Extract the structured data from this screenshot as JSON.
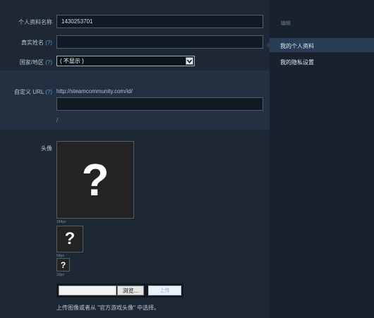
{
  "form": {
    "profile_name": {
      "label": "个人资料名称",
      "value": "1430253701"
    },
    "real_name": {
      "label": "真实姓名",
      "help": "(?)",
      "value": ""
    },
    "country": {
      "label": "国家/地区",
      "help": "(?)",
      "selected": "( 不显示 )"
    },
    "custom_url": {
      "label": "自定义 URL",
      "help": "(?)",
      "prefix": "http://steamcommunity.com/id/",
      "value": "",
      "preview": "/"
    },
    "avatar": {
      "label": "头像",
      "glyph": "?",
      "large_size": "184px",
      "medium_size": "64px",
      "small_size": "32px",
      "browse_label": "浏览...",
      "upload_label": "上传",
      "note": "上传图像或者从 \"官方游戏头像\" 中选择。"
    }
  },
  "sidebar": {
    "heading": "编辑",
    "items": [
      {
        "label": "我的个人资料",
        "active": true
      },
      {
        "label": "我的隐私设置",
        "active": false
      }
    ]
  },
  "colors": {
    "background": "#1d2834",
    "sidebar": "#18222e",
    "active_nav": "#2a3d54",
    "link_help": "#5e9bd1"
  }
}
